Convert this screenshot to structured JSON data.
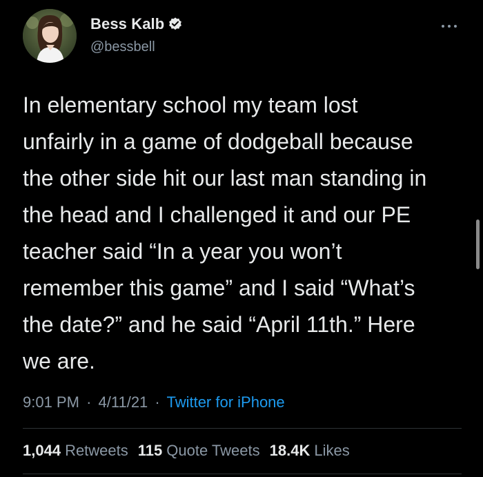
{
  "author": {
    "display_name": "Bess Kalb",
    "handle": "@bessbell",
    "verified": true,
    "avatar_icon": "profile-photo"
  },
  "tweet": {
    "lines": [
      "In elementary school my team lost",
      "unfairly in a game of dodgeball because",
      "the other side hit our last man standing in",
      "the head and I challenged it and our PE",
      "teacher said “In a year you won’t",
      "remember this game” and I said “What’s",
      "the date?” and he said “April 11th.” Here",
      "we are."
    ]
  },
  "meta": {
    "time": "9:01 PM",
    "separator": "·",
    "date": "4/11/21",
    "source": "Twitter for iPhone"
  },
  "stats": {
    "retweets_count": "1,044",
    "retweets_label": "Retweets",
    "quotes_count": "115",
    "quotes_label": "Quote Tweets",
    "likes_count": "18.4K",
    "likes_label": "Likes"
  },
  "colors": {
    "background": "#000000",
    "text_primary": "#e7e9ea",
    "text_secondary": "#8b98a5",
    "link": "#1d9bf0",
    "divider": "#2f3336"
  },
  "icons": {
    "verified": "verified-badge-icon",
    "more": "more-options-icon"
  }
}
